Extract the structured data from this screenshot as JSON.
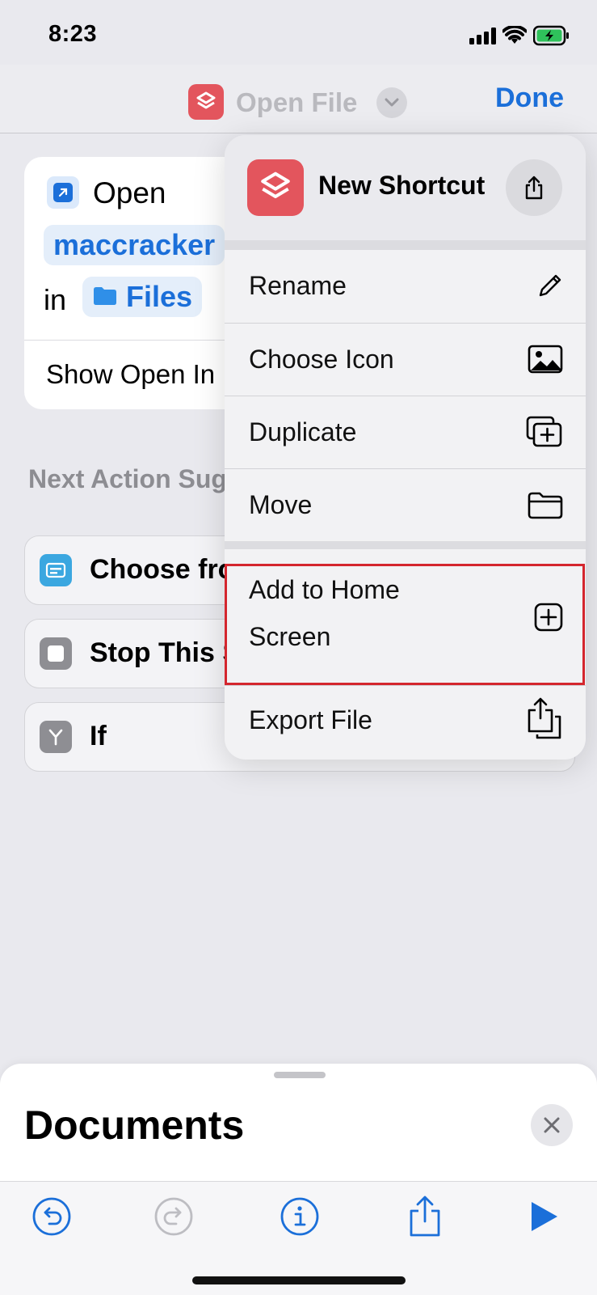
{
  "status_bar": {
    "time": "8:23"
  },
  "nav": {
    "title": "Open File",
    "done_label": "Done"
  },
  "action_card": {
    "verb": "Open",
    "file_token": "maccracker",
    "in_label": "in",
    "app_token": "Files",
    "option_label": "Show Open In"
  },
  "suggestions": {
    "title": "Next Action Suggestions",
    "items": [
      {
        "label": "Choose from Menu",
        "icon": "menu-list-icon",
        "color": "#3ba7e0"
      },
      {
        "label": "Stop This Shortcut",
        "icon": "stop-icon",
        "color": "#8e8e93"
      },
      {
        "label": "If",
        "icon": "branch-icon",
        "color": "#8e8e93"
      }
    ]
  },
  "menu": {
    "shortcut_name": "New Shortcut",
    "items": [
      {
        "label": "Rename",
        "icon": "pencil-icon"
      },
      {
        "label": "Choose Icon",
        "icon": "photo-icon"
      },
      {
        "label": "Duplicate",
        "icon": "duplicate-icon"
      },
      {
        "label": "Move",
        "icon": "folder-icon"
      },
      {
        "label_line1": "Add to Home",
        "label_line2": "Screen",
        "icon": "plus-square-icon"
      },
      {
        "label": "Export File",
        "icon": "export-icon"
      }
    ]
  },
  "sheet": {
    "title": "Documents"
  },
  "colors": {
    "accent": "#1b6fd9",
    "app_icon": "#e3555d",
    "highlight": "#d4262e"
  }
}
